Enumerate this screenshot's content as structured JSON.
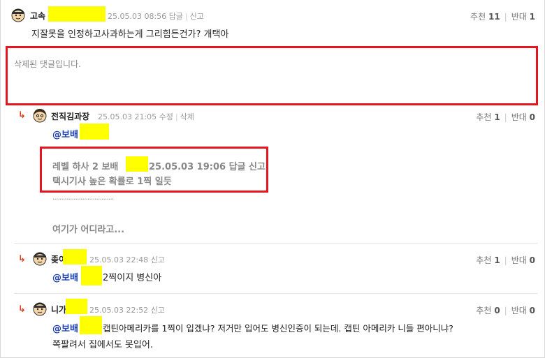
{
  "comments": [
    {
      "nick": "고속",
      "date": "25.05.03 08:56",
      "reply": "답글",
      "report": "신고",
      "text": "지잘못을 인정하고사과하는게 그리힘든건가? 개택아",
      "rec_label": "추천",
      "rec": "11",
      "opp_label": "반대",
      "opp": "1"
    },
    {
      "nick": "전직김과장",
      "date": "25.05.03 21:05",
      "edit": "수정",
      "delete": "삭제",
      "mention": "@보배",
      "quote_line1_a": "레벨 하사 2 보배",
      "quote_line1_b": "25.05.03 19:06 답글 신고",
      "quote_line2": "택시기사 높은 확률로 1찍 일듯",
      "dots": "...................................",
      "text2": "여기가 어디라고...",
      "rec_label": "추천",
      "rec": "1",
      "opp_label": "반대",
      "opp": "0"
    },
    {
      "nick": "좆이",
      "date": "25.05.03 22:48",
      "report": "신고",
      "mention": "@보배",
      "text": "2찍이지 병신아",
      "rec_label": "추천",
      "rec": "1",
      "opp_label": "반대",
      "opp": "0"
    },
    {
      "nick": "니가",
      "date": "25.05.03 22:52",
      "report": "신고",
      "mention": "@보배",
      "text": "캡틴아메리카를 1찍이 입겠냐? 저거만 입어도 병신인증이 되는데. 캡틴 아메리카 니들 편아니냐?",
      "text_line2": "쪽팔려서 집에서도 못입어.",
      "rec_label": "추천",
      "rec": "0",
      "opp_label": "반대",
      "opp": "0"
    }
  ],
  "deleted_notice": "삭제된 댓글입니다.",
  "reply_arrow": "↳",
  "colors": {
    "highlight": "#ffff00",
    "red_box": "#e4161f",
    "mention": "#1a3fb4"
  },
  "icons": [
    "avatar-icon",
    "reply-arrow-icon"
  ]
}
